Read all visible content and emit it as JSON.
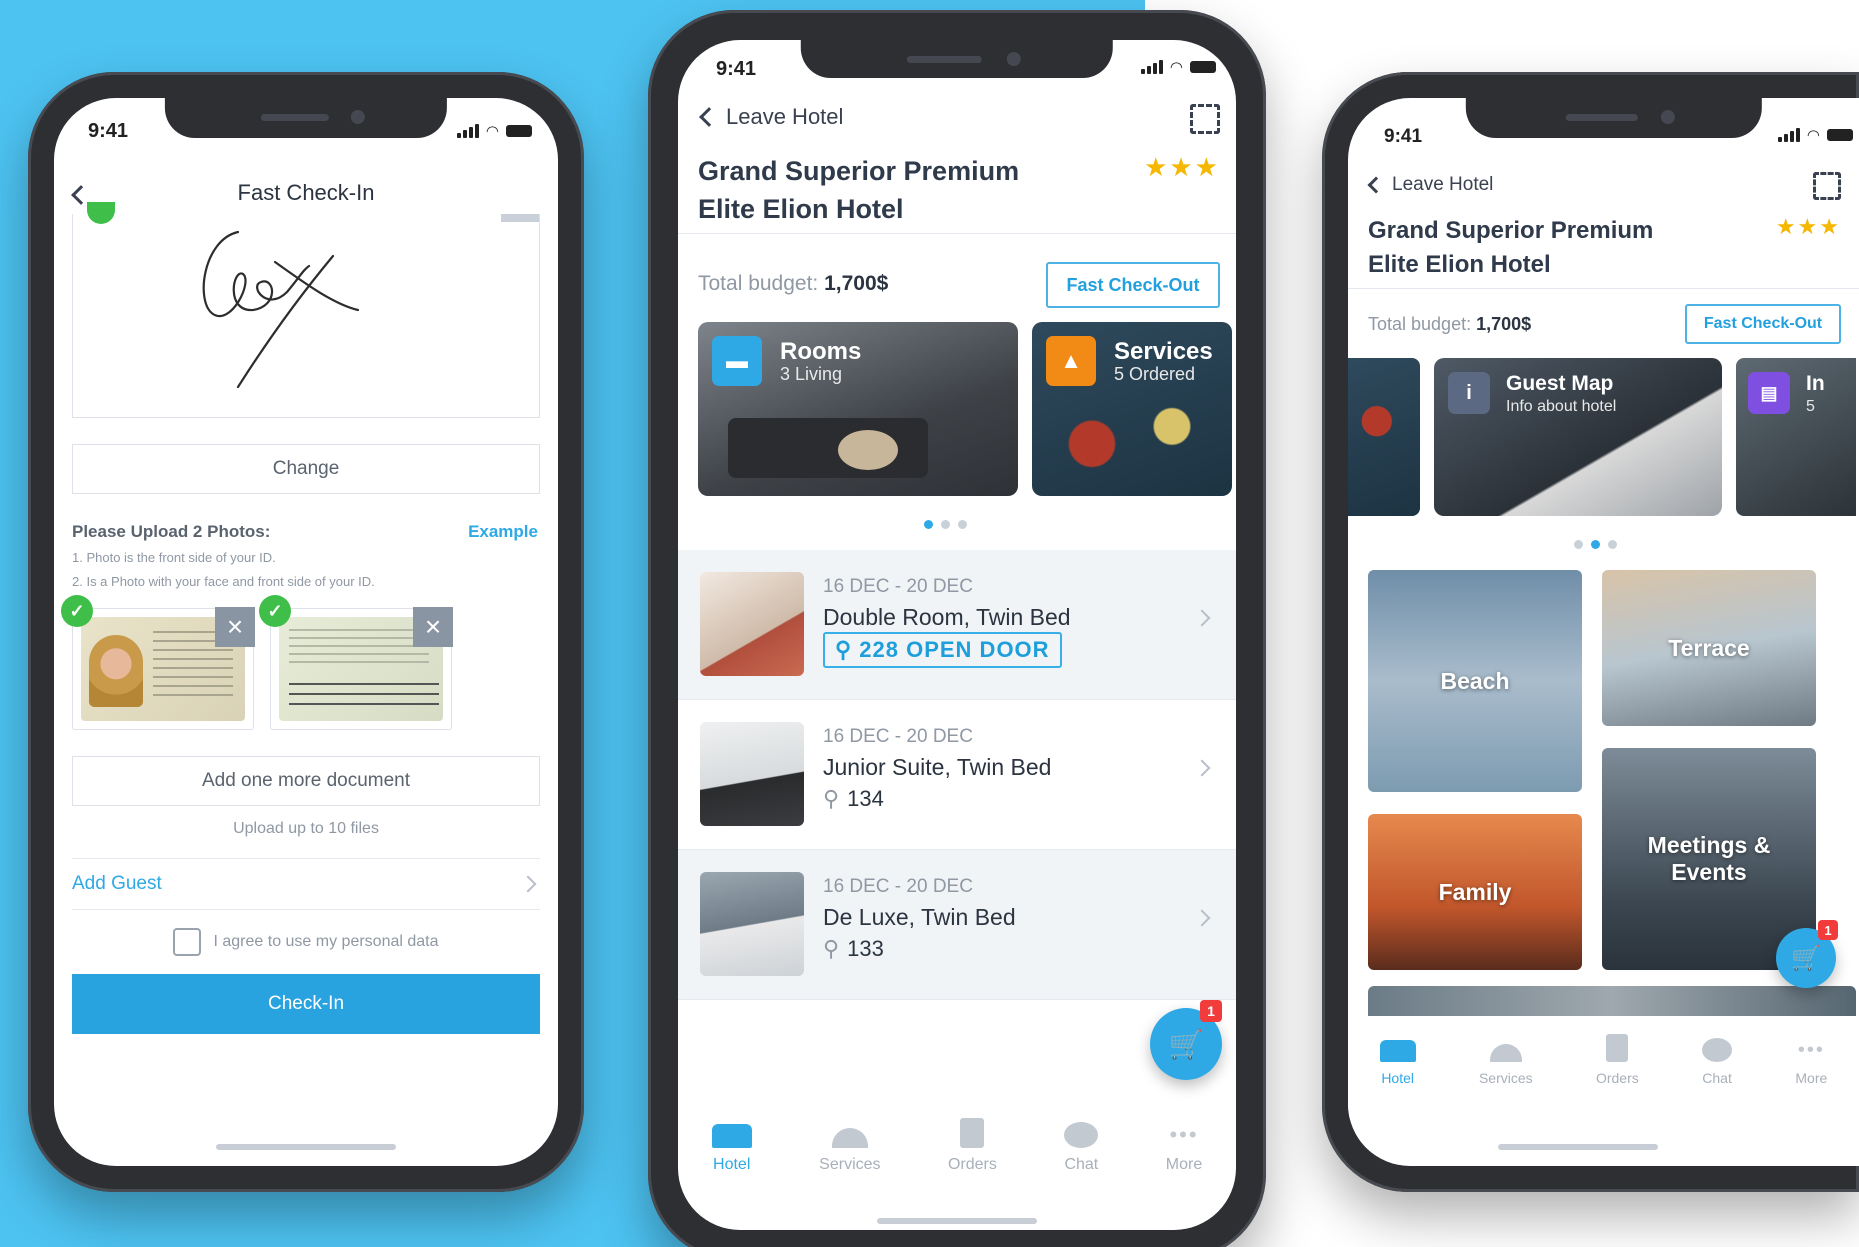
{
  "colors": {
    "background": "#4dc3f2",
    "accent": "#2fa9e6",
    "star": "#f5b700",
    "badge": "#f23b3b",
    "success": "#3fbf4a"
  },
  "phone_left": {
    "status_time": "9:41",
    "title": "Fast Check-In",
    "signature_text": "Cox",
    "change_label": "Change",
    "upload_title": "Please Upload 2 Photos:",
    "example_link": "Example",
    "instruction_1": "1. Photo is the front side of your ID.",
    "instruction_2": "2. Is a Photo with your face and front side of your ID.",
    "add_document_label": "Add one more document",
    "upload_limit": "Upload up to 10 files",
    "add_guest_label": "Add Guest",
    "agree_label": "I agree to use my personal data",
    "checkin_label": "Check-In"
  },
  "phone_center": {
    "status_time": "9:41",
    "back_label": "Leave Hotel",
    "hotel_name_line1": "Grand Superior Premium",
    "hotel_name_line2": "Elite Elion Hotel",
    "stars": "★★★",
    "budget_label": "Total budget:",
    "budget_value": "1,700$",
    "checkout_label": "Fast Check-Out",
    "cards": [
      {
        "title": "Rooms",
        "subtitle": "3 Living",
        "icon": "bed-icon"
      },
      {
        "title": "Services",
        "subtitle": "5 Ordered",
        "icon": "room-service-icon"
      }
    ],
    "bookings": [
      {
        "dates": "16 DEC - 20 DEC",
        "room": "Double Room, Twin Bed",
        "key": "228",
        "action": "OPEN DOOR"
      },
      {
        "dates": "16 DEC - 20 DEC",
        "room": "Junior Suite, Twin Bed",
        "key": "134"
      },
      {
        "dates": "16 DEC - 20 DEC",
        "room": "De Luxe, Twin Bed",
        "key": "133"
      }
    ],
    "cart_badge": "1",
    "tabs": [
      "Hotel",
      "Services",
      "Orders",
      "Chat",
      "More"
    ]
  },
  "phone_right": {
    "status_time": "9:41",
    "back_label": "Leave Hotel",
    "hotel_name_line1": "Grand Superior Premium",
    "hotel_name_line2": "Elite Elion Hotel",
    "stars": "★★★",
    "budget_label": "Total budget:",
    "budget_value": "1,700$",
    "checkout_label": "Fast Check-Out",
    "card": {
      "title": "Guest Map",
      "subtitle": "Info about hotel",
      "icon": "info-icon"
    },
    "card_partial_title": "In",
    "card_partial_sub": "5",
    "tiles": [
      "Beach",
      "Terrace",
      "Family",
      "Meetings &",
      "Events"
    ],
    "cart_badge": "1",
    "tabs": [
      "Hotel",
      "Services",
      "Orders",
      "Chat",
      "More"
    ]
  }
}
